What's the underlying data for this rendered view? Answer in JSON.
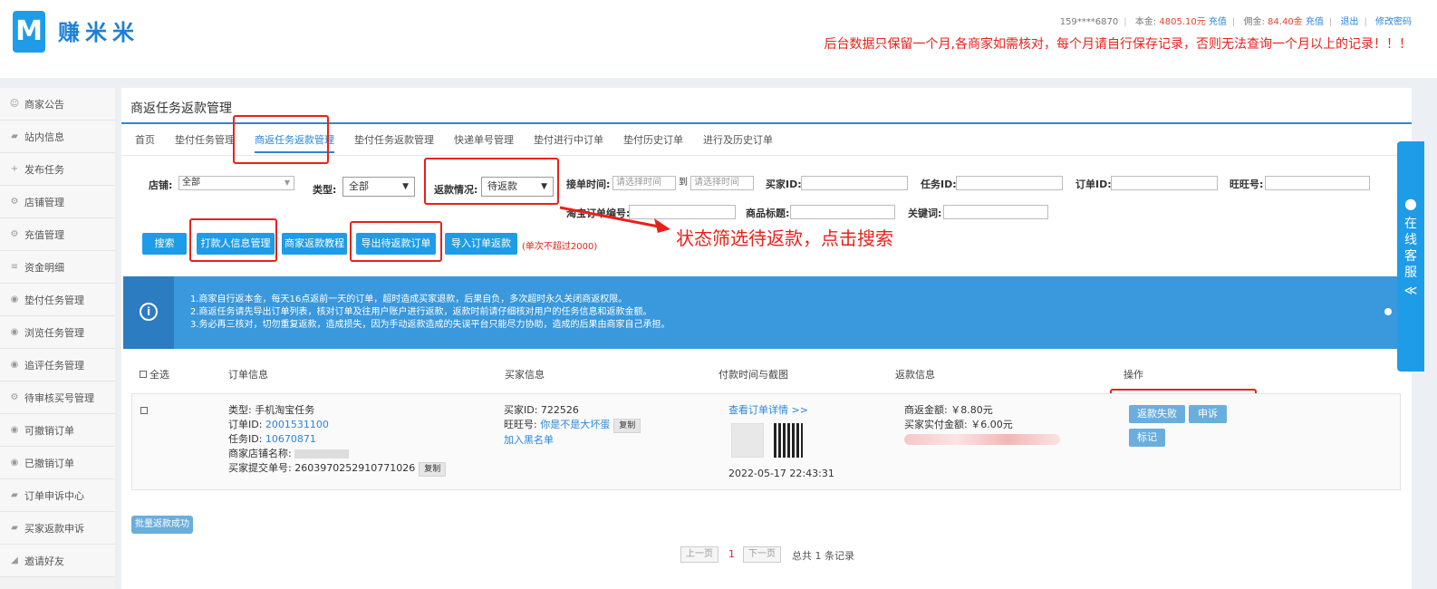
{
  "header": {
    "logo_letter": "M",
    "logo_text": "赚米米",
    "phone": "159****6870",
    "balance_label": "本金:",
    "balance_value": "4805.10元",
    "recharge1": "充值",
    "commission_label": "佣金:",
    "commission_value": "84.40金",
    "recharge2": "充值",
    "logout": "退出",
    "change_password": "修改密码",
    "notice": "后台数据只保留一个月,各商家如需核对，每个月请自行保存记录，否则无法查询一个月以上的记录！！！"
  },
  "sidebar": {
    "items": [
      {
        "label": "商家公告",
        "icon": "☺"
      },
      {
        "label": "站内信息",
        "icon": "▰"
      },
      {
        "label": "发布任务",
        "icon": "+"
      },
      {
        "label": "店铺管理",
        "icon": "⚙"
      },
      {
        "label": "充值管理",
        "icon": "⚙"
      },
      {
        "label": "资金明细",
        "icon": "≡"
      },
      {
        "label": "垫付任务管理",
        "icon": "◉"
      },
      {
        "label": "浏览任务管理",
        "icon": "◉"
      },
      {
        "label": "追评任务管理",
        "icon": "◉"
      },
      {
        "label": "待审核买号管理",
        "icon": "⚙"
      },
      {
        "label": "可撤销订单",
        "icon": "◉"
      },
      {
        "label": "已撤销订单",
        "icon": "◉"
      },
      {
        "label": "订单申诉中心",
        "icon": "▰"
      },
      {
        "label": "买家返款申诉",
        "icon": "▰"
      },
      {
        "label": "邀请好友",
        "icon": "◢"
      }
    ]
  },
  "main": {
    "title": "商返任务返款管理",
    "tabs": [
      "首页",
      "垫付任务管理",
      "商返任务返款管理",
      "垫付任务返款管理",
      "快递单号管理",
      "垫付进行中订单",
      "垫付历史订单",
      "进行及历史订单"
    ],
    "filters": {
      "shop_label": "店铺:",
      "shop_value": "全部",
      "type_label": "类型:",
      "type_value": "全部",
      "refund_status_label": "返款情况:",
      "refund_status_value": "待返款",
      "time_label": "接单时间:",
      "time_start_placeholder": "请选择时间",
      "time_to": "到",
      "time_end_placeholder": "请选择时间",
      "buyer_id_label": "买家ID:",
      "task_id_label": "任务ID:",
      "order_id_label": "订单ID:",
      "wangwang_label": "旺旺号:",
      "taobao_order_label": "淘宝订单编号:",
      "product_title_label": "商品标题:",
      "keyword_label": "关键词:"
    },
    "buttons": {
      "search": "搜索",
      "payer_info": "打款人信息管理",
      "tutorial": "商家返款教程",
      "export": "导出待返款订单",
      "import": "导入订单返款",
      "limit_note": "(单次不超过2000)"
    },
    "annotation": "状态筛选待返款，点击搜索",
    "info_lines": [
      "1.商家自行返本金，每天16点返前一天的订单，超时造成买家退款，后果自负，多次超时永久关闭商返权限。",
      "2.商返任务请先导出订单列表，核对订单及往用户账户进行返款，返款时前请仔细核对用户的任务信息和返款金额。",
      "3.务必再三核对，切勿重复返款，造成损失，因为手动返款造成的失误平台只能尽力协助，造成的后果由商家自己承担。"
    ],
    "table": {
      "headers": {
        "select_all": "全选",
        "order_info": "订单信息",
        "buyer_info": "买家信息",
        "pay_time": "付款时间与截图",
        "refund_info": "返款信息",
        "actions": "操作"
      },
      "row": {
        "type_label": "类型:",
        "type_value": "手机淘宝任务",
        "order_id_label": "订单ID:",
        "order_id": "2001531100",
        "task_id_label": "任务ID:",
        "task_id": "10670871",
        "shop_name_label": "商家店铺名称:",
        "buyer_order_label": "买家提交单号:",
        "buyer_order": "2603970252910771026",
        "copy": "复制",
        "buyer_id_label": "买家ID:",
        "buyer_id": "722526",
        "wangwang_label": "旺旺号:",
        "wangwang": "你是不是大坏蛋",
        "blacklist": "加入黑名单",
        "view_detail": "查看订单详情 >>",
        "pay_time": "2022-05-17 22:43:31",
        "rebate_label": "商返金额:",
        "rebate_value": "￥8.80元",
        "paid_label": "买家实付金额:",
        "paid_value": "￥6.00元",
        "btn_fail": "返款失败",
        "btn_appeal": "申诉",
        "btn_mark": "标记"
      }
    },
    "batch_button": "批量返款成功",
    "pager": {
      "prev": "上一页",
      "current": "1",
      "next": "下一页",
      "total": "总共 1 条记录"
    }
  },
  "customer_service": {
    "label": "在线客服",
    "icon": "≪"
  },
  "colors": {
    "accent": "#1e9ce8",
    "annotation": "#e8211b",
    "infobar": "#3a98dc"
  }
}
